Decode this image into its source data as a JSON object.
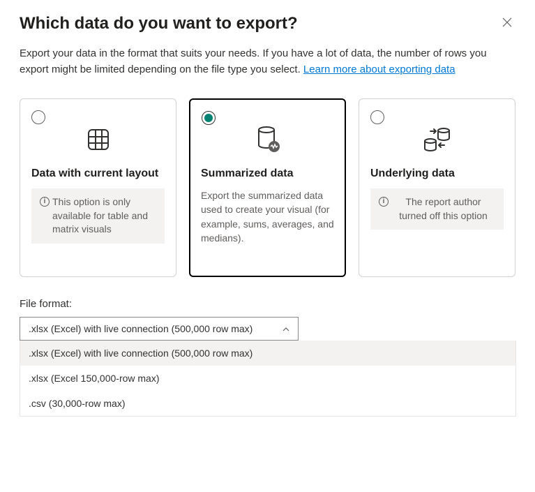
{
  "dialog": {
    "title": "Which data do you want to export?",
    "description_prefix": "Export your data in the format that suits your needs. If you have a lot of data, the number of rows you export might be limited depending on the file type you select.  ",
    "learn_more": "Learn more about exporting data"
  },
  "options": {
    "current_layout": {
      "title": "Data with current layout",
      "note": "This option is only available for table and matrix visuals"
    },
    "summarized": {
      "title": "Summarized data",
      "description": "Export the summarized data used to create your visual (for example, sums, averages, and medians)."
    },
    "underlying": {
      "title": "Underlying data",
      "note": "The report author turned off this option"
    }
  },
  "file_format": {
    "label": "File format:",
    "selected": ".xlsx (Excel) with live connection (500,000 row max)",
    "options": [
      ".xlsx (Excel) with live connection (500,000 row max)",
      ".xlsx (Excel 150,000-row max)",
      ".csv (30,000-row max)"
    ]
  }
}
